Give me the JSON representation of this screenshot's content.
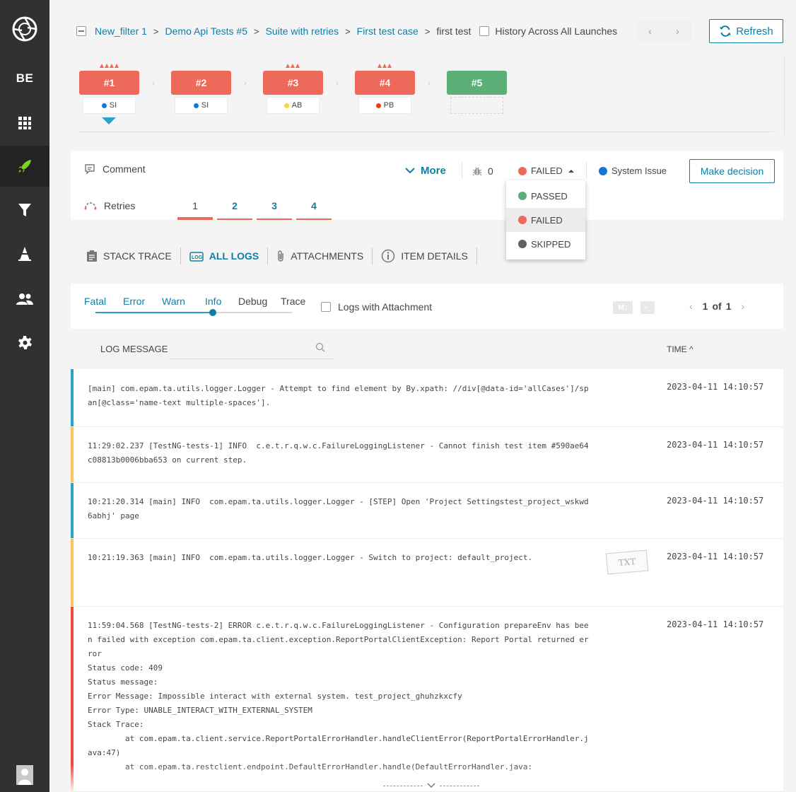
{
  "sidebar": {
    "project": "BE",
    "items": [
      {
        "name": "dashboard",
        "icon": "grid-icon"
      },
      {
        "name": "launches",
        "icon": "rocket-icon",
        "active": true
      },
      {
        "name": "filters",
        "icon": "filter-icon"
      },
      {
        "name": "debug",
        "icon": "cone-icon"
      },
      {
        "name": "members",
        "icon": "users-icon"
      },
      {
        "name": "settings",
        "icon": "gear-icon"
      }
    ]
  },
  "header": {
    "breadcrumbs": [
      "New_filter 1",
      "Demo Api Tests #5",
      "Suite with retries",
      "First test case"
    ],
    "current": "first test",
    "history_label": "History Across All Launches",
    "refresh_label": "Refresh"
  },
  "history": [
    {
      "label": "#1",
      "status": "failed",
      "defect": "SI",
      "defect_color": "#1774cf",
      "triangles": 4
    },
    {
      "label": "#2",
      "status": "failed",
      "defect": "SI",
      "defect_color": "#1774cf",
      "triangles": 0
    },
    {
      "label": "#3",
      "status": "failed",
      "defect": "AB",
      "defect_color": "#f7d63e",
      "triangles": 3
    },
    {
      "label": "#4",
      "status": "failed",
      "defect": "PB",
      "defect_color": "#e13f17",
      "triangles": 3
    },
    {
      "label": "#5",
      "status": "passed",
      "defect": "",
      "defect_color": "",
      "triangles": 0
    }
  ],
  "panel": {
    "comment_label": "Comment",
    "more_label": "More",
    "bug_count": "0",
    "status": "FAILED",
    "defect_type": "System Issue",
    "make_decision_label": "Make decision",
    "retries_label": "Retries",
    "retries": [
      "1",
      "2",
      "3",
      "4"
    ]
  },
  "status_dropdown": {
    "options": [
      {
        "label": "PASSED",
        "color": "#5cb077"
      },
      {
        "label": "FAILED",
        "color": "#ed6a5a",
        "selected": true
      },
      {
        "label": "SKIPPED",
        "color": "#616161"
      }
    ]
  },
  "tabs": [
    "STACK TRACE",
    "ALL LOGS",
    "ATTACHMENTS",
    "ITEM DETAILS"
  ],
  "active_tab": "ALL LOGS",
  "filters": {
    "levels": [
      "Fatal",
      "Error",
      "Warn",
      "Info",
      "Debug",
      "Trace"
    ],
    "selected_level": "Info",
    "logs_with_attachment_label": "Logs with Attachment",
    "md_label": "M↓",
    "console_label": ">_",
    "page_current": "1",
    "page_of": "of",
    "page_total": "1"
  },
  "log_header": {
    "message_label": "LOG MESSAGE",
    "time_label": "TIME ^"
  },
  "logs": [
    {
      "level": "info",
      "color": "#2ba3c9",
      "message": "[main] com.epam.ta.utils.logger.Logger - Attempt to find element by By.xpath: //div[@data-id='allCases']/span[@class='name-text multiple-spaces'].",
      "time": "2023-04-11 14:10:57"
    },
    {
      "level": "warn",
      "color": "#ffc05e",
      "message": "11:29:02.237 [TestNG-tests-1] INFO  c.e.t.r.q.w.c.FailureLoggingListener - Cannot finish test item #590ae64c08813b0006bba653 on current step.",
      "time": "2023-04-11 14:10:57"
    },
    {
      "level": "info",
      "color": "#2ba3c9",
      "message": "10:21:20.314 [main] INFO  com.epam.ta.utils.logger.Logger - [STEP] Open 'Project Settingstest_project_wskwd6abhj' page",
      "time": "2023-04-11 14:10:57"
    },
    {
      "level": "warn",
      "color": "#ffc05e",
      "message": "10:21:19.363 [main] INFO  com.epam.ta.utils.logger.Logger - Switch to project: default_project.",
      "time": "2023-04-11 14:10:57",
      "attachment": "TXT"
    },
    {
      "level": "error",
      "color": "#ed4c3d",
      "message": "11:59:04.568 [TestNG-tests-2] ERROR c.e.t.r.q.w.c.FailureLoggingListener - Configuration prepareEnv has been failed with exception com.epam.ta.client.exception.ReportPortalClientException: Report Portal returned error\nStatus code: 409\nStatus message:\nError Message: Impossible interact with external system. test_project_ghuhzkxcfy\nError Type: UNABLE_INTERACT_WITH_EXTERNAL_SYSTEM\nStack Trace:\n        at com.epam.ta.client.service.ReportPortalErrorHandler.handleClientError(ReportPortalErrorHandler.java:47)\n        at com.epam.ta.restclient.endpoint.DefaultErrorHandler.handle(DefaultErrorHandler.java:",
      "time": "2023-04-11 14:10:57"
    }
  ]
}
